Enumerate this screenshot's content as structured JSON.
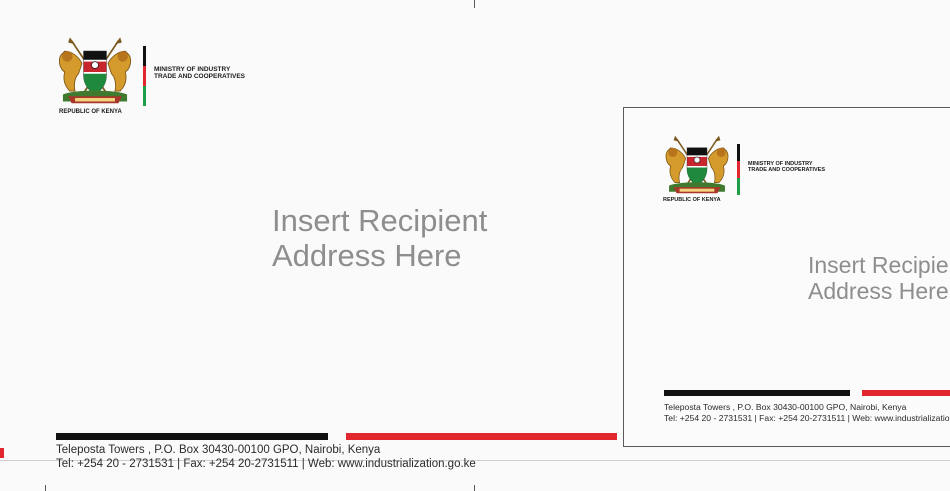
{
  "letterhead": {
    "ministry_line1": "MINISTRY OF INDUSTRY",
    "ministry_line2": "TRADE AND COOPERATIVES",
    "republic": "REPUBLIC OF KENYA",
    "crest_icon": "kenya-coat-of-arms-icon"
  },
  "recipient": {
    "line1": "Insert Recipient",
    "line2": "Address Here"
  },
  "footer": {
    "address": "Teleposta Towers , P.O. Box 30430-00100 GPO, Nairobi, Kenya",
    "contact": "Tel: +254 20 - 2731531 | Fax: +254 20-2731511 | Web: www.industrialization.go.ke"
  },
  "colors": {
    "black": "#111111",
    "red": "#e1262d",
    "green": "#1f9e4a",
    "recipient_text": "#8e8e8e"
  }
}
